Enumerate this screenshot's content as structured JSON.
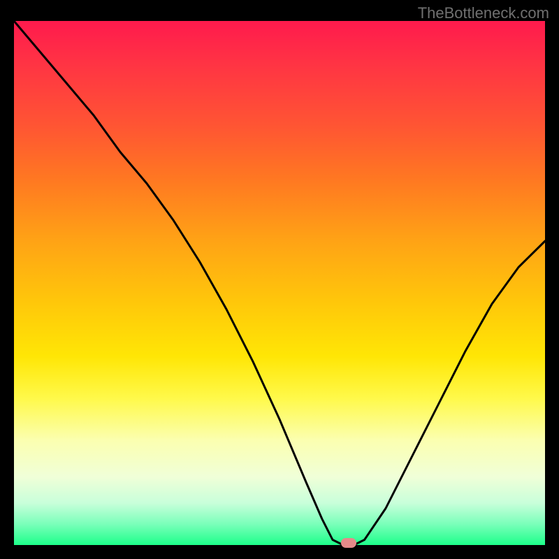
{
  "watermark": "TheBottleneck.com",
  "colors": {
    "background": "#000000",
    "regions": [
      "#ff1a4d",
      "#ff7722",
      "#ffe605",
      "#1dff8a"
    ],
    "curve": "#000000",
    "marker": "#e58a8a"
  },
  "chart_data": {
    "type": "line",
    "title": "",
    "xlabel": "",
    "ylabel": "",
    "xlim": [
      0,
      100
    ],
    "ylim": [
      0,
      100
    ],
    "grid": false,
    "legend": false,
    "description": "Bottleneck V-curve: y represents bottleneck percentage, x represents hardware balance. Curve descends from top-left, reaches minimum near x=63 (marker location, ~0% bottleneck / green zone), then rises again toward the right.",
    "marker": {
      "x": 63,
      "y": 0
    },
    "series": [
      {
        "name": "bottleneck-curve",
        "x": [
          0,
          5,
          10,
          15,
          20,
          25,
          30,
          35,
          40,
          45,
          50,
          55,
          58,
          60,
          62,
          64,
          66,
          70,
          75,
          80,
          85,
          90,
          95,
          100
        ],
        "values": [
          100,
          94,
          88,
          82,
          75,
          69,
          62,
          54,
          45,
          35,
          24,
          12,
          5,
          1,
          0,
          0,
          1,
          7,
          17,
          27,
          37,
          46,
          53,
          58
        ]
      }
    ]
  }
}
